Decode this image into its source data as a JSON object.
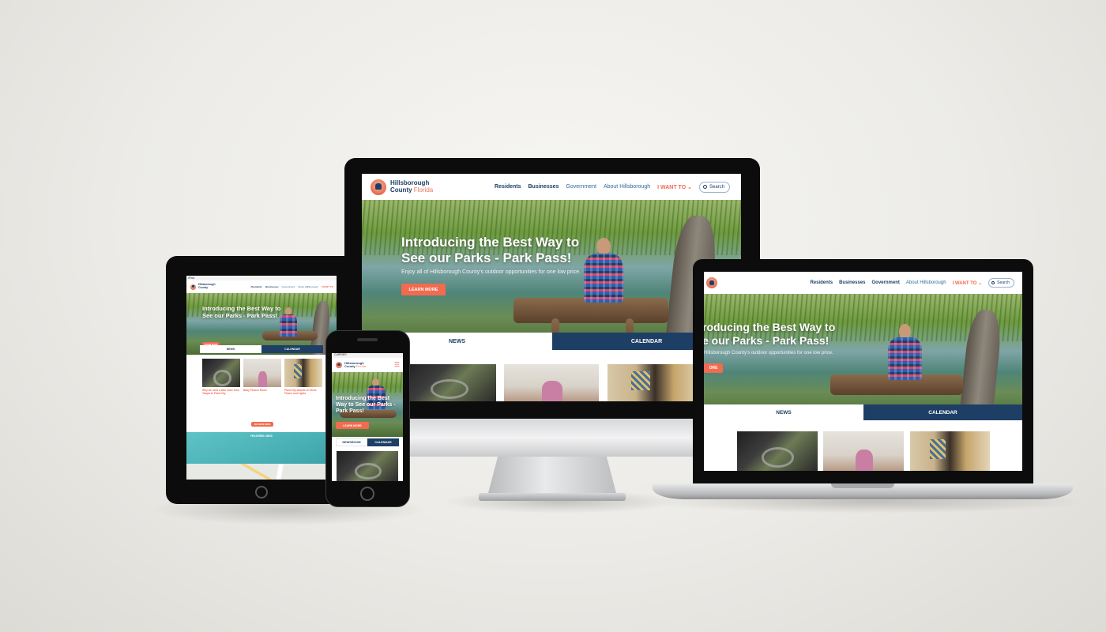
{
  "site": {
    "logo": {
      "line1": "Hillsborough",
      "line2": "County",
      "line3": "Florida"
    },
    "nav": {
      "residents": "Residents",
      "businesses": "Businesses",
      "government": "Government",
      "about": "About Hillsborough",
      "want": "I WANT TO",
      "search_label": "Search"
    },
    "hero": {
      "title_line1": "Introducing the Best Way to",
      "title_line2": "See our Parks - Park Pass!",
      "subtitle": "Enjoy all of Hillsborough County's outdoor opportunities for one low price.",
      "button": "LEARN MORE"
    },
    "tabs": {
      "news": "NEWS",
      "calendar": "CALENDAR",
      "newsroom": "NEWSROOM"
    }
  },
  "laptop": {
    "hero_title_line1": "roducing the Best Way to",
    "hero_title_line2": "e our Parks - Park Pass!",
    "hero_subtitle": "Hillsborough County's outdoor opportunities for one low price.",
    "button": "ORE"
  },
  "phone": {
    "carrier": "CARRIER",
    "hero_title": "Introducing the Best Way to See our Parks - Park Pass!"
  },
  "tablet": {
    "status": "iPad",
    "news": "NEWS",
    "calendar": "CALENDAR",
    "cards": [
      {
        "title": "Why we need a bike route from Tampa to Plant City"
      },
      {
        "title": "Baby Fitness Room"
      },
      {
        "title": "Plant City awards of Citrus Flower and Lights"
      }
    ],
    "more_button": "SEE MORE NEWS",
    "featured_title": "FEATURED LINKS"
  },
  "colors": {
    "brand_navy": "#1d3f66",
    "accent_coral": "#f26b50",
    "featured_teal": "#49b1b6"
  }
}
